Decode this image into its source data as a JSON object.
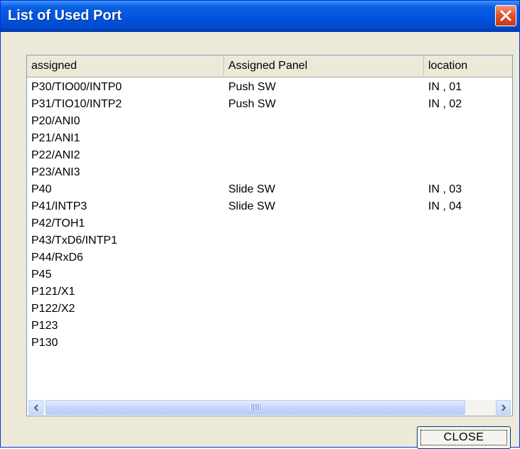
{
  "window": {
    "title": "List of Used Port"
  },
  "columns": [
    {
      "label": "assigned"
    },
    {
      "label": "Assigned Panel"
    },
    {
      "label": "location"
    }
  ],
  "rows": [
    {
      "assigned": "P30/TIO00/INTP0",
      "panel": "Push SW",
      "location": "IN , 01"
    },
    {
      "assigned": "P31/TIO10/INTP2",
      "panel": "Push SW",
      "location": "IN , 02"
    },
    {
      "assigned": "P20/ANI0",
      "panel": "",
      "location": ""
    },
    {
      "assigned": "P21/ANI1",
      "panel": "",
      "location": ""
    },
    {
      "assigned": "P22/ANI2",
      "panel": "",
      "location": ""
    },
    {
      "assigned": "P23/ANI3",
      "panel": "",
      "location": ""
    },
    {
      "assigned": "P40",
      "panel": "Slide SW",
      "location": "IN , 03"
    },
    {
      "assigned": "P41/INTP3",
      "panel": "Slide SW",
      "location": "IN , 04"
    },
    {
      "assigned": "P42/TOH1",
      "panel": "",
      "location": ""
    },
    {
      "assigned": "P43/TxD6/INTP1",
      "panel": "",
      "location": ""
    },
    {
      "assigned": "P44/RxD6",
      "panel": "",
      "location": ""
    },
    {
      "assigned": "P45",
      "panel": "",
      "location": ""
    },
    {
      "assigned": "P121/X1",
      "panel": "",
      "location": ""
    },
    {
      "assigned": "P122/X2",
      "panel": "",
      "location": ""
    },
    {
      "assigned": "P123",
      "panel": "",
      "location": ""
    },
    {
      "assigned": "P130",
      "panel": "",
      "location": ""
    }
  ],
  "buttons": {
    "close_label": "CLOSE"
  },
  "icons": {
    "close": "close-icon",
    "scroll_left": "chevron-left-icon",
    "scroll_right": "chevron-right-icon"
  },
  "colors": {
    "titlebar": "#0054e3",
    "close_button": "#e0542c",
    "window_bg": "#ece9d8"
  }
}
